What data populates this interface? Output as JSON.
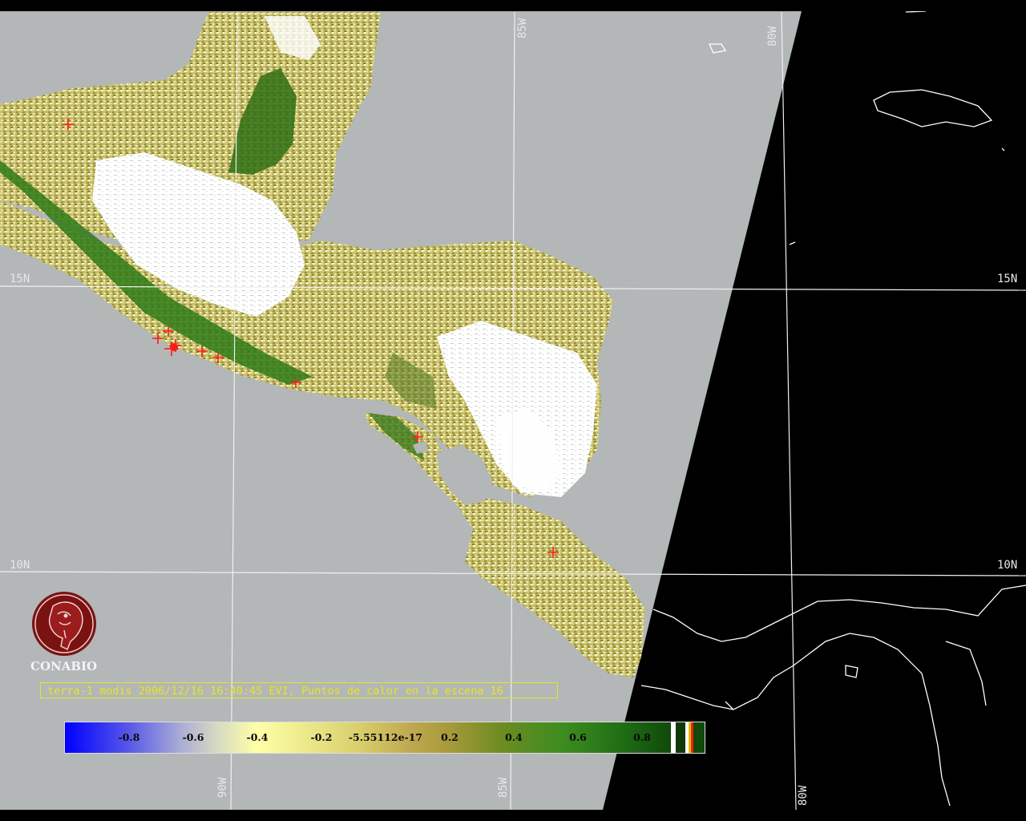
{
  "map": {
    "caption": "terra-1 modis 2006/12/16 16:40:45 EVI, Puntos de calor en la escena 16",
    "colors": {
      "ocean": "#b3b7b8",
      "no_data": "#000000",
      "cloud": "#ffffff",
      "grid": "#f0f0f0",
      "hotspot": "#ff1a1a",
      "coastline": "#ffffff",
      "caption": "#e6e61e"
    },
    "grid_labels": {
      "lat_15_left": "15N",
      "lat_15_right": "15N",
      "lat_10_left": "10N",
      "lat_10_right": "10N",
      "lon_85_top": "85W",
      "lon_80_top": "80W",
      "lon_90_bottom": "90W",
      "lon_85_bottom": "85W",
      "lon_80_bottom": "80W"
    },
    "colorbar": {
      "ticks": [
        "-0.8",
        "-0.6",
        "-0.4",
        "-0.2",
        "-5.55112e-17",
        "0.2",
        "0.4",
        "0.6",
        "0.8"
      ]
    },
    "logo": {
      "text": "CONABIO",
      "icon": "conabio-macaw-seal-icon"
    }
  }
}
